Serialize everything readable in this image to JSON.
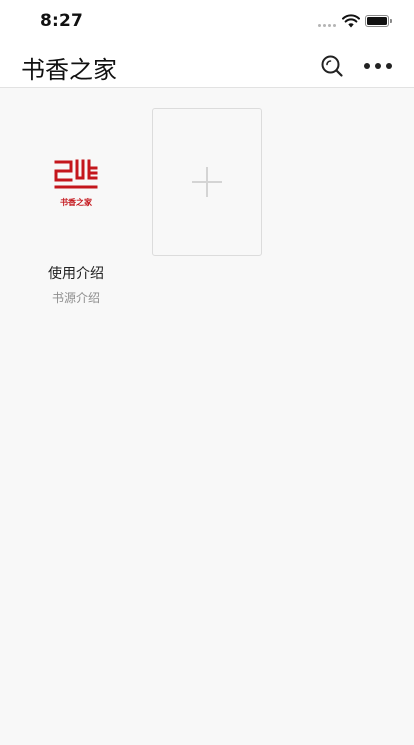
{
  "status_bar": {
    "time": "8:27"
  },
  "nav": {
    "title": "书香之家"
  },
  "icons": {
    "search": "search-icon",
    "more": "more-icon",
    "add": "plus-icon",
    "wifi": "wifi-icon",
    "battery": "battery-icon",
    "signal": "signal-icon"
  },
  "books": [
    {
      "cover_logo_text": "书香之家",
      "title": "使用介绍",
      "subtitle": "书源介绍"
    }
  ],
  "colors": {
    "brand_red": "#c4161c",
    "background": "#f8f8f8",
    "bar": "#ffffff"
  }
}
